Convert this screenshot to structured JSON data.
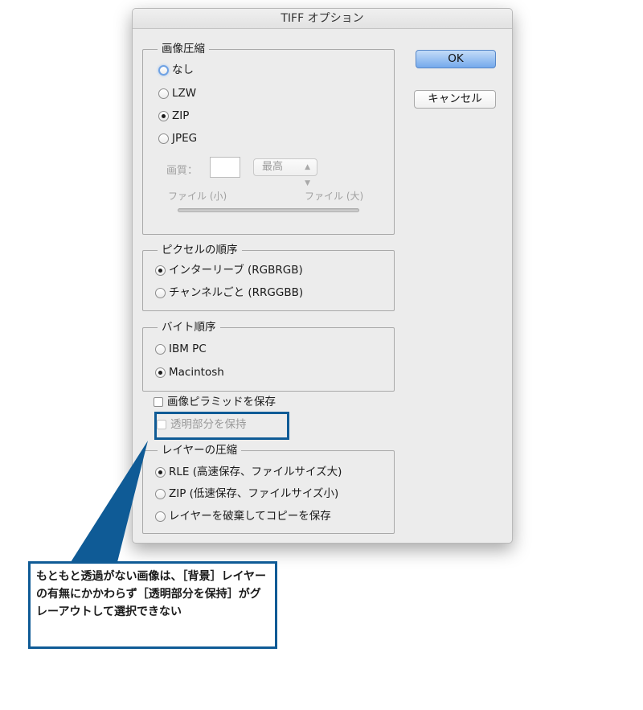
{
  "dialog": {
    "title": "TIFF オプション",
    "ok_label": "OK",
    "cancel_label": "キャンセル"
  },
  "image_compression": {
    "legend": "画像圧縮",
    "options": [
      "なし",
      "LZW",
      "ZIP",
      "JPEG"
    ],
    "selected": "ZIP",
    "quality_label": "画質：",
    "quality_value": "",
    "quality_select": "最高",
    "file_small": "ファイル (小)",
    "file_large": "ファイル (大)"
  },
  "pixel_order": {
    "legend": "ピクセルの順序",
    "options": [
      "インターリーブ (RGBRGB)",
      "チャンネルごと (RRGGBB)"
    ],
    "selected": "インターリーブ (RGBRGB)"
  },
  "byte_order": {
    "legend": "バイト順序",
    "options": [
      "IBM PC",
      "Macintosh"
    ],
    "selected": "Macintosh"
  },
  "checkboxes": {
    "save_pyramid": "画像ピラミッドを保存",
    "save_transparency": "透明部分を保持"
  },
  "layer_compression": {
    "legend": "レイヤーの圧縮",
    "options": [
      "RLE (高速保存、ファイルサイズ大)",
      "ZIP (低速保存、ファイルサイズ小)",
      "レイヤーを破棄してコピーを保存"
    ],
    "selected": "RLE (高速保存、ファイルサイズ大)"
  },
  "callout": {
    "text": "もともと透過がない画像は、［背景］レイヤーの有無にかかわらず［透明部分を保持］がグレーアウトして選択できない"
  },
  "colors": {
    "accent": "#0f5b96",
    "ok_button": "#74a9ec"
  }
}
